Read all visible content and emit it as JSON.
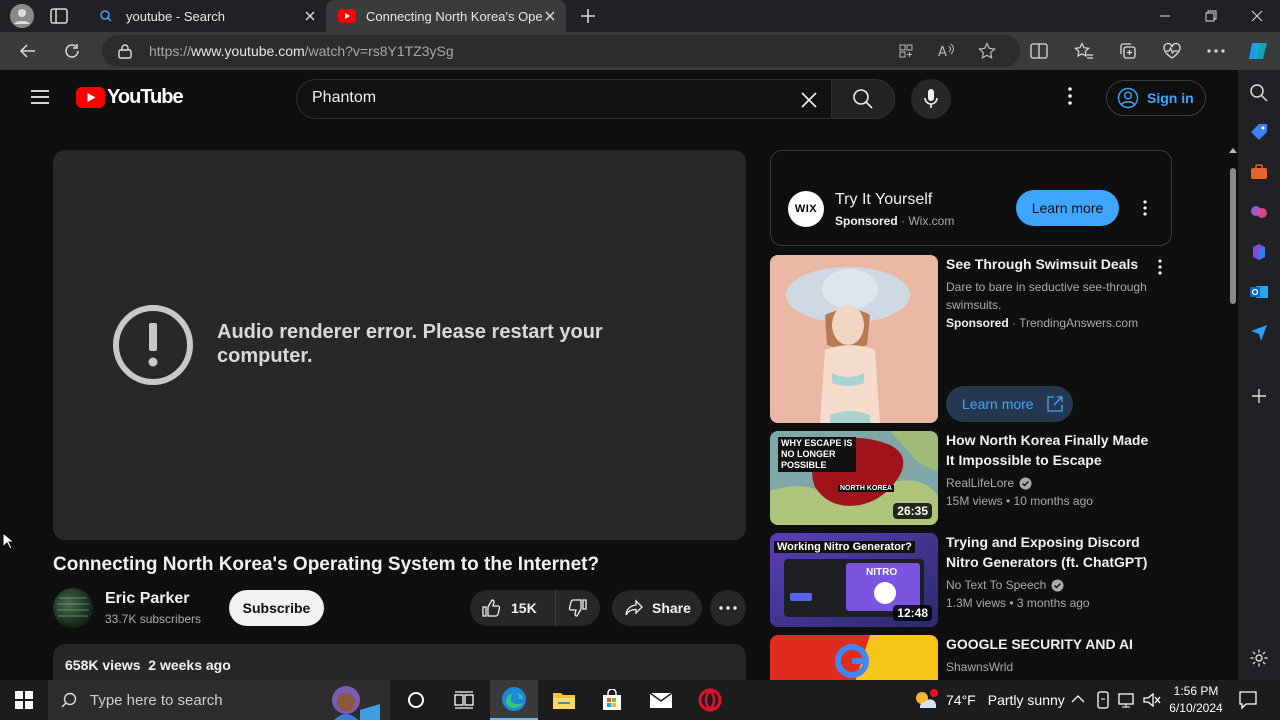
{
  "browser": {
    "tabs": [
      {
        "title": "youtube - Search",
        "active": false
      },
      {
        "title": "Connecting North Korea's Operating System to the Internet?",
        "active": true
      }
    ],
    "url_prefix": "https://",
    "url_host": "www.youtube.com",
    "url_path": "/watch?v=rs8Y1TZ3ySg"
  },
  "youtube": {
    "logo_text": "YouTube",
    "search_value": "Phantom",
    "sign_in_label": "Sign in",
    "player_error": "Audio renderer error. Please restart your computer.",
    "video": {
      "title": "Connecting North Korea's Operating System to the Internet?",
      "channel": "Eric Parker",
      "subscribers": "33.7K subscribers",
      "subscribe_label": "Subscribe",
      "likes": "15K",
      "share_label": "Share",
      "views_date": "658K views  2 weeks ago"
    },
    "sidebar": {
      "ad_top": {
        "logo": "WIX",
        "title": "Try It Yourself",
        "sponsored": "Sponsored",
        "source": "Wix.com",
        "cta": "Learn more"
      },
      "ad_second": {
        "title": "See Through Swimsuit Deals",
        "description": "Dare to bare in seductive see-through swimsuits.",
        "sponsored": "Sponsored",
        "source": "TrendingAnswers.com",
        "cta": "Learn more"
      },
      "videos": [
        {
          "title": "How North Korea Finally Made It Impossible to Escape",
          "channel": "RealLifeLore",
          "meta": "15M views • 10 months ago",
          "duration": "26:35",
          "thumb_caption": "WHY ESCAPE IS NO LONGER POSSIBLE",
          "thumb_label": "NORTH KOREA"
        },
        {
          "title": "Trying and Exposing Discord Nitro Generators (ft. ChatGPT)",
          "channel": "No Text To Speech",
          "meta": "1.3M views • 3 months ago",
          "duration": "12:48",
          "thumb_caption": "Working Nitro Generator?",
          "thumb_label": "NITRO"
        },
        {
          "title": "GOOGLE SECURITY AND AI",
          "channel": "ShawnsWrld",
          "meta": "",
          "duration": ""
        }
      ]
    }
  },
  "taskbar": {
    "search_placeholder": "Type here to search",
    "weather_temp": "74°F",
    "weather_desc": "Partly sunny",
    "time": "1:56 PM",
    "date": "6/10/2024"
  },
  "colors": {
    "accent_blue": "#3ea6ff",
    "youtube_red": "#ff0000",
    "background": "#0f0f0f"
  }
}
